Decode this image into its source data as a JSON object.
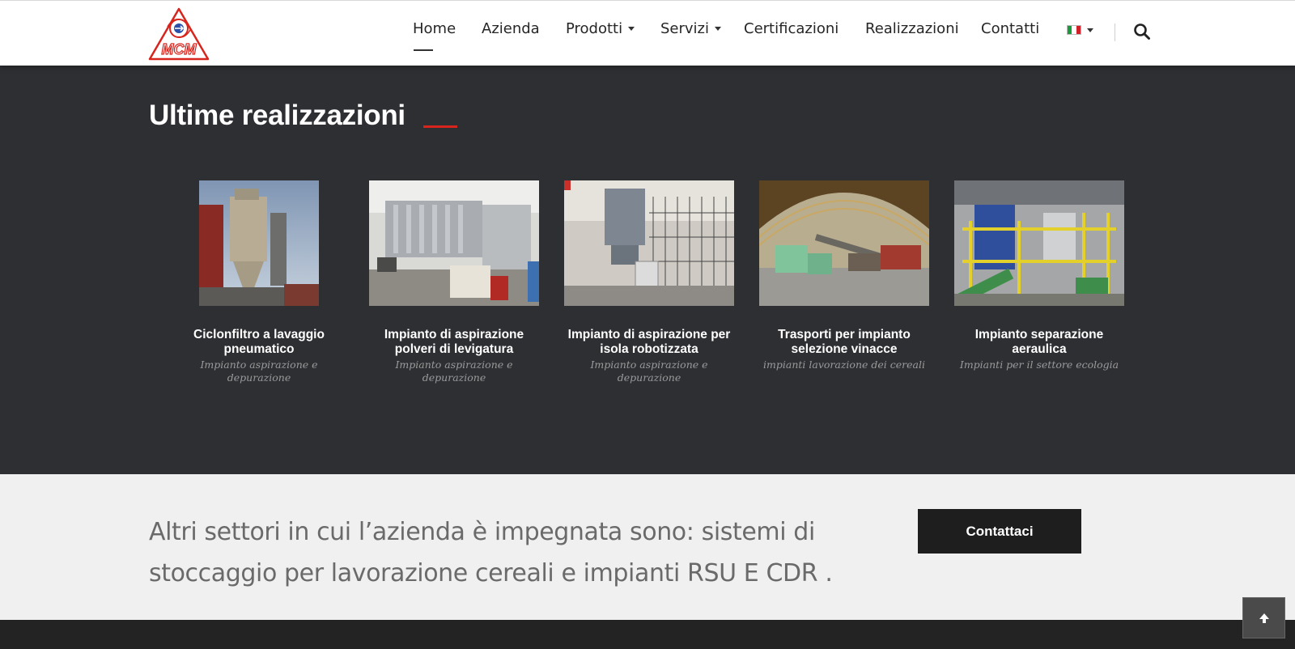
{
  "header": {
    "logo_text": "MCM",
    "nav": [
      {
        "label": "Home",
        "active": true
      },
      {
        "label": "Azienda"
      },
      {
        "label": "Prodotti",
        "dropdown": true
      },
      {
        "label": "Servizi",
        "dropdown": true
      },
      {
        "label": "Certificazioni"
      },
      {
        "label": "Realizzazioni"
      },
      {
        "label": "Contatti"
      }
    ],
    "language_icon": "italian-flag-icon",
    "search_icon": "search-icon"
  },
  "section": {
    "title": "Ultime realizzazioni",
    "accent_color": "#d7241c",
    "items": [
      {
        "title": "Ciclonfiltro a lavaggio pneumatico",
        "category": "Impianto aspirazione e depurazione"
      },
      {
        "title": "Impianto di aspirazione polveri di levigatura",
        "category": "Impianto aspirazione e depurazione"
      },
      {
        "title": "Impianto di aspirazione per isola robotizzata",
        "category": "Impianto aspirazione e depurazione"
      },
      {
        "title": "Trasporti per impianto selezione vinacce",
        "category": "impianti lavorazione dei cereali"
      },
      {
        "title": "Impianto separazione aeraulica",
        "category": "Impianti per il settore ecologia"
      }
    ]
  },
  "cta": {
    "text": "Altri settori in cui l’azienda è impegnata sono: sistemi di stoccaggio per lavorazione cereali e impianti RSU E CDR .",
    "button_label": "Contattaci"
  },
  "colors": {
    "dark_bg": "#2e2f33",
    "cta_bg": "#f0f0f0",
    "button_bg": "#1e1e1e"
  }
}
